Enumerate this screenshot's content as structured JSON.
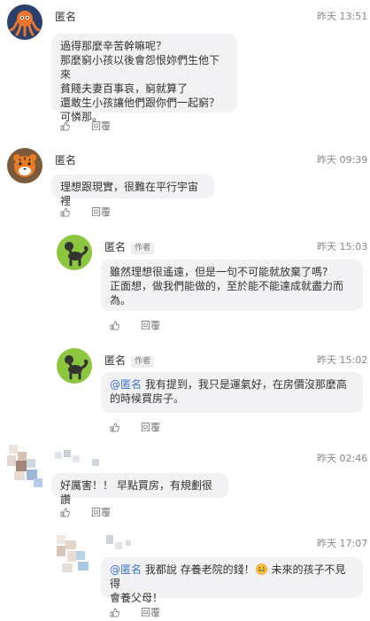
{
  "comments": [
    {
      "name": "匿名",
      "time": "昨天 13:51",
      "text": "過得那麼辛苦幹嘛呢？\n那麼窮小孩以後會怨恨妳們生他下來\n貧賤夫妻百事哀，窮就算了\n還敢生小孩讓他們跟你們一起窮？\n可憐那。",
      "reply_label": "回覆"
    },
    {
      "name": "匿名",
      "time": "昨天 09:39",
      "text": "理想跟現實，很難在平行宇宙裡",
      "reply_label": "回覆"
    },
    {
      "name": "匿名",
      "badge": "作者",
      "time": "昨天 15:03",
      "text": "雖然理想很遙遠，但是一句不可能就放棄了嗎?\n正面想，做我們能做的，至於能不能達成就盡力而\n為。",
      "reply_label": "回覆"
    },
    {
      "name": "匿名",
      "badge": "作者",
      "time": "昨天 15:02",
      "mention": "@匿名",
      "text": " 我有提到，我只是運氣好，在房價沒那麼高\n的時候買房子。",
      "reply_label": "回覆"
    },
    {
      "time": "昨天 02:46",
      "text": "好厲害！！ 早點買房，有規劃很讚",
      "reply_label": "回覆"
    },
    {
      "time": "昨天 17:07",
      "mention": "@匿名",
      "text_a": " 我都說 存養老院的錢！",
      "text_b": " 未來的孩子不見得\n會養父母！",
      "reply_label": "回覆"
    }
  ],
  "icons": {
    "like": "thumbs-up-icon",
    "emoji": "grinning-face-icon"
  },
  "colors": {
    "mention": "#3d74c6",
    "bubble": "#f2f2f4"
  }
}
